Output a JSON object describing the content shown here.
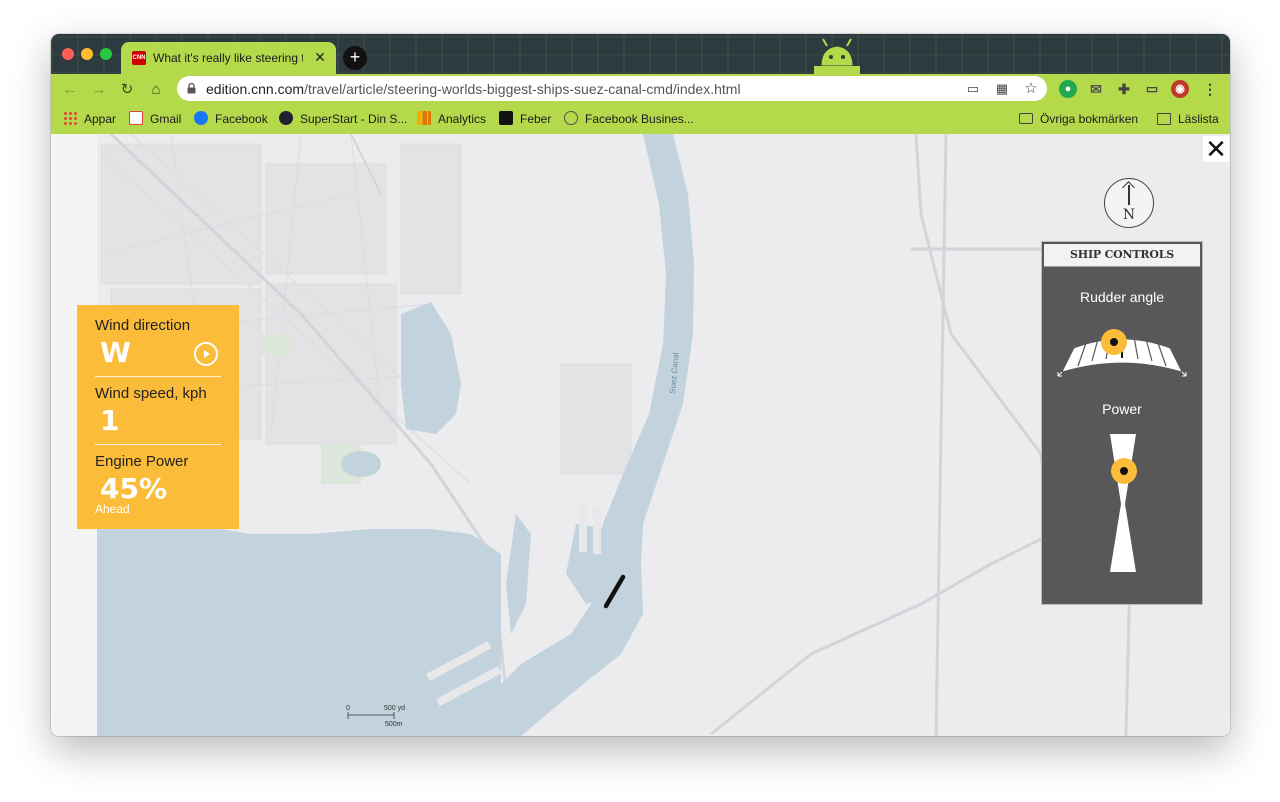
{
  "browser": {
    "tab_title": "What it's really like steering the",
    "tab_favicon_text": "CNN",
    "url_host": "edition.cnn.com",
    "url_path": "/travel/article/steering-worlds-biggest-ships-suez-canal-cmd/index.html",
    "theme_color": "#b4d94b"
  },
  "bookmarks": {
    "items": [
      {
        "label": "Appar",
        "icon": "apps-grid-icon"
      },
      {
        "label": "Gmail",
        "icon": "gmail-icon"
      },
      {
        "label": "Facebook",
        "icon": "facebook-icon"
      },
      {
        "label": "SuperStart - Din S...",
        "icon": "superstart-icon"
      },
      {
        "label": "Analytics",
        "icon": "analytics-icon"
      },
      {
        "label": "Feber",
        "icon": "feber-icon"
      },
      {
        "label": "Facebook Busines...",
        "icon": "facebook-business-icon"
      }
    ],
    "other_label": "Övriga bokmärken",
    "reading_list_label": "Läslista"
  },
  "map": {
    "canal_label": "Suez Canal",
    "scale_zero": "0",
    "scale_yd": "500 yd",
    "scale_m": "500m",
    "water_color": "#c2d3dd",
    "land_color": "#ececee"
  },
  "compass": {
    "letter": "N"
  },
  "wind_panel": {
    "direction_label": "Wind direction",
    "direction_value": "W",
    "speed_label": "Wind speed, kph",
    "speed_value": "1",
    "power_label": "Engine Power",
    "power_value": "45%",
    "power_sub": "Ahead",
    "color": "#fbbc3a"
  },
  "ship_controls": {
    "title": "SHIP CONTROLS",
    "rudder_label": "Rudder angle",
    "power_label": "Power",
    "knob_color": "#fbbc3a"
  }
}
